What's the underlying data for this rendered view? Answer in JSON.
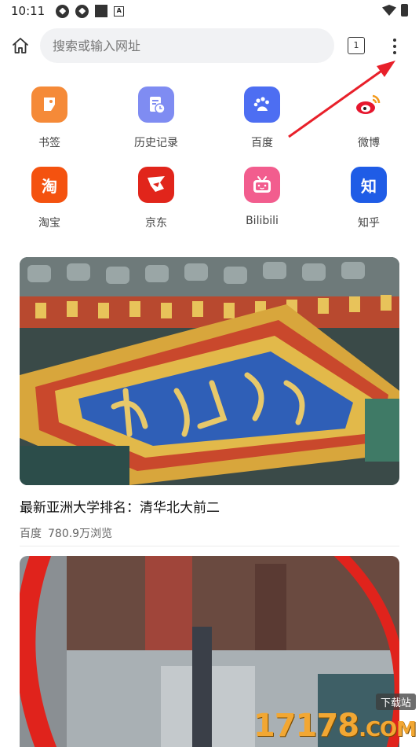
{
  "status_bar": {
    "time": "10:11",
    "icons_left": [
      "settings-sync-icon",
      "settings-sync-icon",
      "stop-square-icon",
      "a-badge-icon"
    ],
    "icons_right": [
      "wifi-icon",
      "battery-charging-icon"
    ]
  },
  "top_bar": {
    "home_icon": "home-icon",
    "search_placeholder": "搜索或输入网址",
    "tab_count": "1",
    "menu_icon": "more-vert-icon"
  },
  "shortcuts": [
    {
      "label": "书签",
      "icon": "bookmark-icon",
      "color": "#f58a38",
      "glyph": ""
    },
    {
      "label": "历史记录",
      "icon": "history-icon",
      "color": "#7f8cf2",
      "glyph": ""
    },
    {
      "label": "百度",
      "icon": "baidu-paw-icon",
      "color": "#4d6ef2",
      "glyph": ""
    },
    {
      "label": "微博",
      "icon": "weibo-icon",
      "color": "#ffffff",
      "glyph": ""
    },
    {
      "label": "淘宝",
      "icon": "taobao-icon",
      "color": "#f4520f",
      "glyph": "淘"
    },
    {
      "label": "京东",
      "icon": "jd-dog-icon",
      "color": "#e1251b",
      "glyph": ""
    },
    {
      "label": "Bilibili",
      "icon": "bilibili-tv-icon",
      "color": "#f25d8e",
      "glyph": ""
    },
    {
      "label": "知乎",
      "icon": "zhihu-icon",
      "color": "#1f5ce6",
      "glyph": "知"
    }
  ],
  "news": [
    {
      "title": "最新亚洲大学排名：清华北大前二",
      "source": "百度",
      "views": "780.9万浏览",
      "image": "peking-university-gate-plaque"
    },
    {
      "title": "",
      "source": "",
      "views": "",
      "image": "blurred-street-scene-red-ring"
    }
  ],
  "watermark": {
    "top": "下载站",
    "main": "17178",
    "sub": ".COM"
  },
  "colors": {
    "annotation_arrow": "#e8202a",
    "accent": "#4d6ef2"
  }
}
